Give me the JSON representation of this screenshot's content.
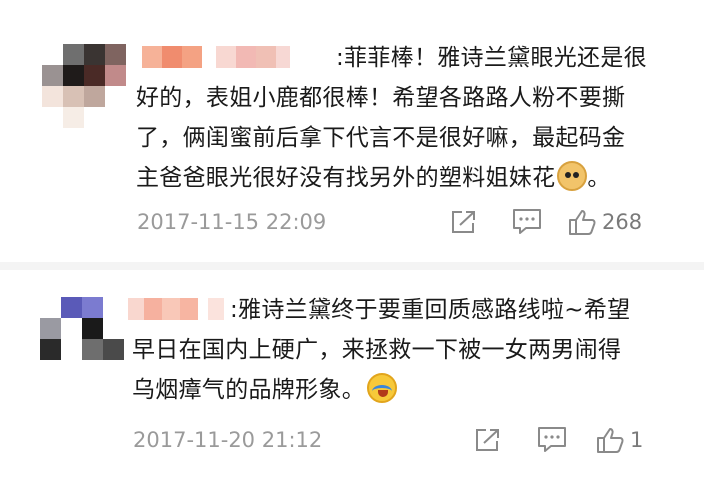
{
  "comments": [
    {
      "avatar_colors": [
        "#ffffff",
        "#6f6f6f",
        "#3a3432",
        "#7f6460",
        "#9a9292",
        "#1f1b1a",
        "#4a2a26",
        "#c18a8a",
        "#f3e4dc",
        "#d8c1b5",
        "#bfa79d",
        "#ffffff",
        "#ffffff",
        "#f6ede6",
        "#ffffff",
        "#ffffff"
      ],
      "name_colors": [
        "#f6b298",
        "#f08c6e",
        "#f4a283",
        "#ffffff",
        "#f8d8d2",
        "#f2b9b4",
        "#f0c0b5",
        "#f7d8d4"
      ],
      "lines": [
        ":菲菲棒！雅诗兰黛眼光还是很",
        "好的，表姐小鹿都很棒！希望各路路人粉不要撕",
        "了，俩闺蜜前后拿下代言不是很好嘛，最起码金",
        "主爸爸眼光很好没有找另外的塑料姐妹花"
      ],
      "trailing_text": "。",
      "emoji": "doge-emoji",
      "timestamp": "2017-11-15 22:09",
      "like_count": "268"
    },
    {
      "avatar_colors": [
        "#ffffff",
        "#5a5ab8",
        "#7b7bd0",
        "#ffffff",
        "#9a9aa2",
        "#ffffff",
        "#1a1a1a",
        "#ffffff",
        "#2a2a2a",
        "#ffffff",
        "#6e6e6e",
        "#4a4a4a",
        "#ffffff",
        "#ffffff",
        "#ffffff",
        "#ffffff"
      ],
      "name_colors": [
        "#f9d7cf",
        "#f6b19f",
        "#f9c8b8",
        "#f7b5a2",
        "#ffffff",
        "#fbe3dd"
      ],
      "lines": [
        ":雅诗兰黛终于要重回质感路线啦~希望",
        "早日在国内上硬广，来拯救一下被一女两男闹得",
        "乌烟瘴气的品牌形象。"
      ],
      "trailing_text": "",
      "emoji": "crying-laughing-emoji",
      "timestamp": "2017-11-20 21:12",
      "like_count": "1"
    }
  ],
  "colors": {
    "text": "#1a1a1a",
    "meta": "#9a9a9a",
    "icon": "#8a8a8a",
    "divider": "#f4f4f4"
  }
}
